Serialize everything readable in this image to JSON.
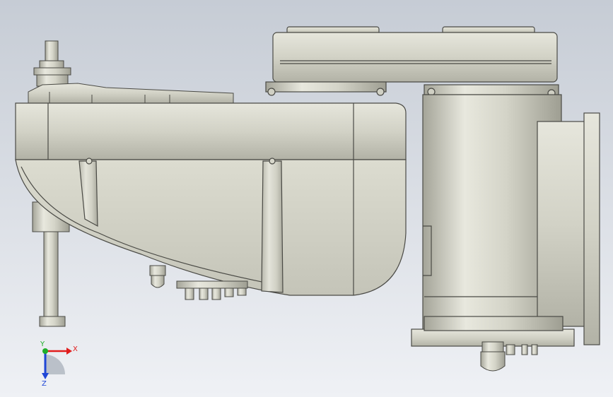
{
  "viewport": {
    "background_top": "#c9ced6",
    "background_bottom": "#eef0f4",
    "body_color": "#d6d6c9",
    "body_shade": "#a9a99c",
    "edge_color": "#4a4a45"
  },
  "triad": {
    "x_label": "X",
    "y_label": "Y",
    "z_label": "Z",
    "x_color": "#e11d1d",
    "y_color": "#1fae2a",
    "z_color": "#1f46d6"
  }
}
